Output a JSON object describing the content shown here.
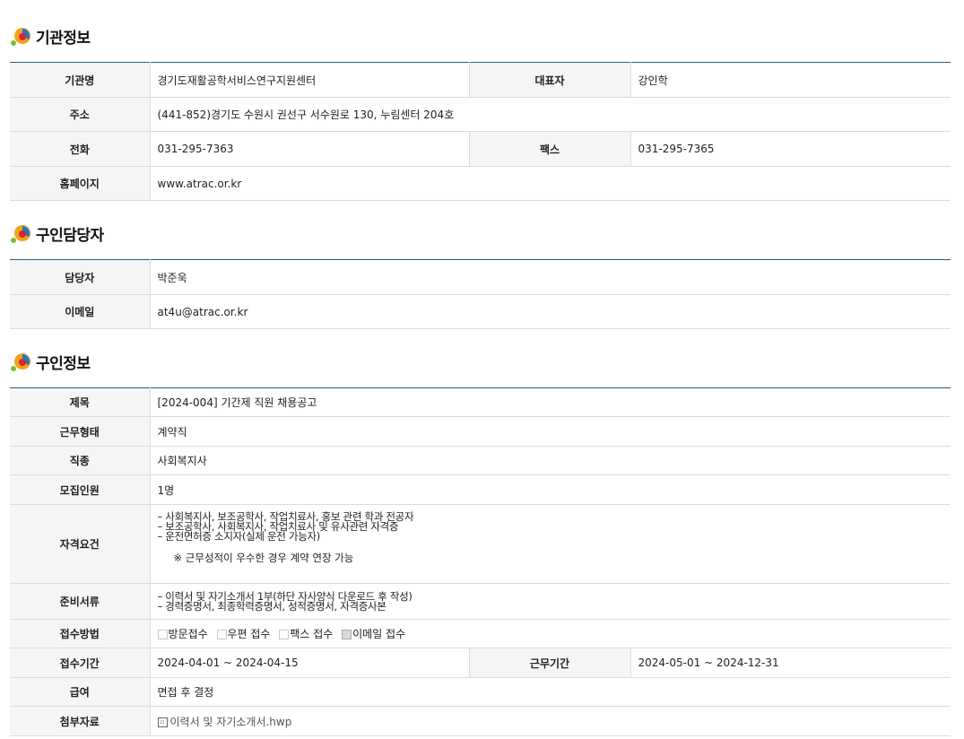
{
  "sections": {
    "agency_title": "기관정보",
    "contact_title": "구인담당자",
    "job_title": "구인정보"
  },
  "agency": {
    "name_label": "기관명",
    "name": "경기도재활공학서비스연구지원센터",
    "rep_label": "대표자",
    "rep": "강인학",
    "address_label": "주소",
    "address": "(441-852)경기도 수원시 권선구 서수원로 130, 누림센터 204호",
    "phone_label": "전화",
    "phone": "031-295-7363",
    "fax_label": "팩스",
    "fax": "031-295-7365",
    "homepage_label": "홈페이지",
    "homepage": "www.atrac.or.kr"
  },
  "contact": {
    "person_label": "담당자",
    "person": "박준욱",
    "email_label": "이메일",
    "email": "at4u@atrac.or.kr"
  },
  "job": {
    "title_label": "제목",
    "title": "[2024-004] 기간제 직원 채용공고",
    "type_label": "근무형태",
    "type": "계약직",
    "occupation_label": "직종",
    "occupation": "사회복지사",
    "headcount_label": "모집인원",
    "headcount": "1명",
    "qual_label": "자격요건",
    "qual_lines": [
      "– 사회복지사, 보조공학사, 작업치료사, 홍보 관련 학과 전공자",
      "– 보조공학사, 사회복지사, 작업치료사 및 유사관련 자격증",
      "– 운전면허증 소지자(실제 운전 가능자)"
    ],
    "qual_note": "※ 근무성적이 우수한 경우 계약 연장 가능",
    "docs_label": "준비서류",
    "docs_lines": [
      "– 이력서 및 자기소개서 1부(하단 자사양식 다운로드 후 작성)",
      "– 경력증명서, 최종학력증명서, 성적증명서, 자격증사본"
    ],
    "method_label": "접수방법",
    "methods": [
      {
        "label": "방문접수",
        "checked": false
      },
      {
        "label": "우편 접수",
        "checked": false
      },
      {
        "label": "팩스 접수",
        "checked": false
      },
      {
        "label": "이메일 접수",
        "checked": true
      }
    ],
    "period_label": "접수기간",
    "period": "2024-04-01 ~ 2024-04-15",
    "work_period_label": "근무기간",
    "work_period": "2024-05-01 ~ 2024-12-31",
    "salary_label": "급여",
    "salary": "면접 후 결정",
    "attach_label": "첨부자료",
    "attach_file": "이력서 및 자기소개서.hwp"
  }
}
